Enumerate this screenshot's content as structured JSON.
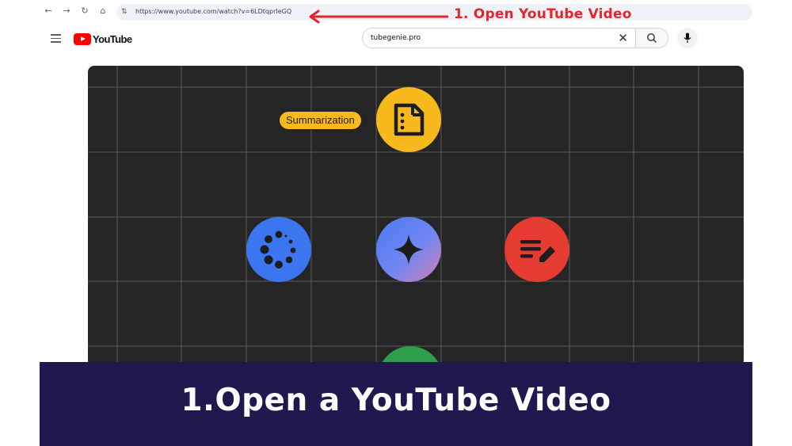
{
  "browser": {
    "url": "https://www.youtube.com/watch?v=6LDtqprIeGQ",
    "icons": [
      "back-icon",
      "forward-icon",
      "reload-icon",
      "home-icon",
      "site-info-icon"
    ]
  },
  "annotation": {
    "label": "1. Open YouTube Video",
    "color": "#e3262c"
  },
  "youtube": {
    "logo_text": "YouTube",
    "search_query": "tubegenie.pro"
  },
  "video": {
    "feature_label": "Summarization",
    "colors": {
      "summarization": "#f7b91b",
      "loading": "#3b76f0",
      "edit": "#e63b30",
      "green": "#2e9e4a",
      "background": "#252525"
    }
  },
  "caption": {
    "text": "1.Open a YouTube Video",
    "background": "#1f1950"
  }
}
